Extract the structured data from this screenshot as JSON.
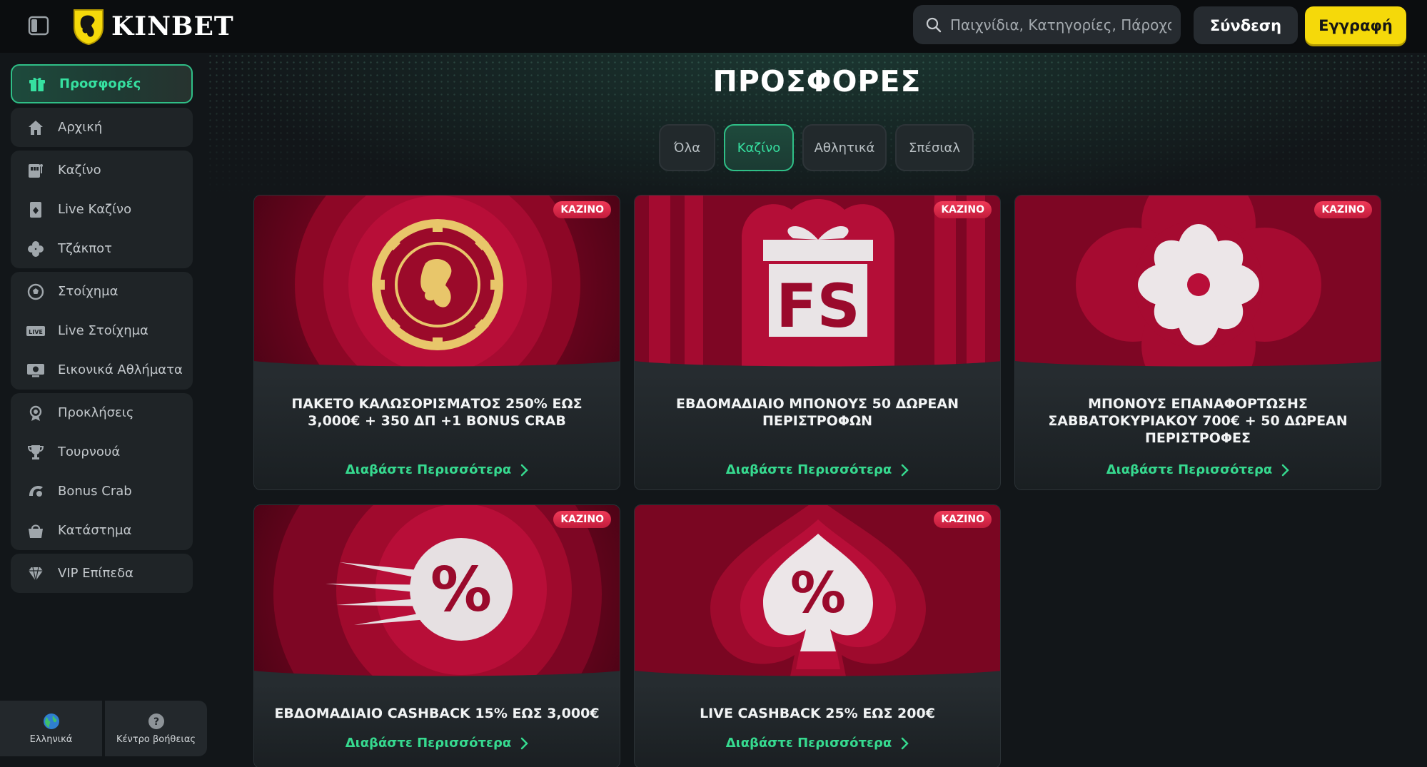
{
  "header": {
    "logo_text": "KINBET",
    "search_placeholder": "Παιχνίδια, Κατηγορίες, Πάροχοι",
    "login_label": "Σύνδεση",
    "register_label": "Εγγραφή"
  },
  "sidebar": {
    "items": [
      {
        "label": "Προσφορές",
        "icon": "gift-icon"
      },
      {
        "label": "Αρχική",
        "icon": "home-icon"
      },
      {
        "label": "Καζίνο",
        "icon": "slot-machine-icon"
      },
      {
        "label": "Live Καζίνο",
        "icon": "live-casino-icon"
      },
      {
        "label": "Τζάκποτ",
        "icon": "clover-icon"
      },
      {
        "label": "Στοίχημα",
        "icon": "soccer-ball-icon"
      },
      {
        "label": "Live Στοίχημα",
        "icon": "live-badge-icon"
      },
      {
        "label": "Εικονικά Αθλήματα",
        "icon": "virtual-sports-icon"
      },
      {
        "label": "Προκλήσεις",
        "icon": "challenge-icon"
      },
      {
        "label": "Τουρνουά",
        "icon": "trophy-icon"
      },
      {
        "label": "Bonus Crab",
        "icon": "crab-icon"
      },
      {
        "label": "Κατάστημα",
        "icon": "shop-bag-icon"
      },
      {
        "label": "VIP Επίπεδα",
        "icon": "diamond-icon"
      }
    ],
    "language_label": "Ελληνικά",
    "help_label": "Κέντρο βοήθειας"
  },
  "main": {
    "title": "ΠΡΟΣΦΟΡΕΣ",
    "tabs": [
      "Όλα",
      "Καζίνο",
      "Αθλητικά",
      "Σπέσιαλ"
    ],
    "active_tab": "Καζίνο",
    "cards": [
      {
        "badge": "KAZINO",
        "title": "ΠΑΚΕΤΟ ΚΑΛΩΣΟΡΙΣΜΑΤΟΣ 250% ΕΩΣ 3,000€ + 350 ΔΠ +1 BONUS CRAB",
        "link": "Διαβάστε Περισσότερα",
        "art": "casino-chip"
      },
      {
        "badge": "KAZINO",
        "title": "ΕΒΔΟΜΑΔΙΑΙΟ ΜΠΟΝΟΥΣ 50 ΔΩΡΕΑΝ ΠΕΡΙΣΤΡΟΦΩΝ",
        "link": "Διαβάστε Περισσότερα",
        "art": "fs-gift"
      },
      {
        "badge": "KAZINO",
        "title": "ΜΠΟΝΟΥΣ ΕΠΑΝΑΦΟΡΤΩΣΗΣ ΣΑΒΒΑΤΟΚΥΡΙΑΚΟΥ 700€ + 50 ΔΩΡΕΑΝ ΠΕΡΙΣΤΡΟΦΕΣ",
        "link": "Διαβάστε Περισσότερα",
        "art": "clover"
      },
      {
        "badge": "KAZINO",
        "title": "ΕΒΔΟΜΑΔΙΑΙΟ CASHBACK 15% ΕΩΣ 3,000€",
        "link": "Διαβάστε Περισσότερα",
        "art": "percent-comet"
      },
      {
        "badge": "KAZINO",
        "title": "LIVE CASHBACK 25% ΕΩΣ 200€",
        "link": "Διαβάστε Περισσότερα",
        "art": "percent-spade"
      }
    ]
  },
  "colors": {
    "accent_green": "#36e0a0",
    "register_yellow": "#f5d90a",
    "badge_red": "#e0304f",
    "card_red": "#9a0a2c"
  }
}
